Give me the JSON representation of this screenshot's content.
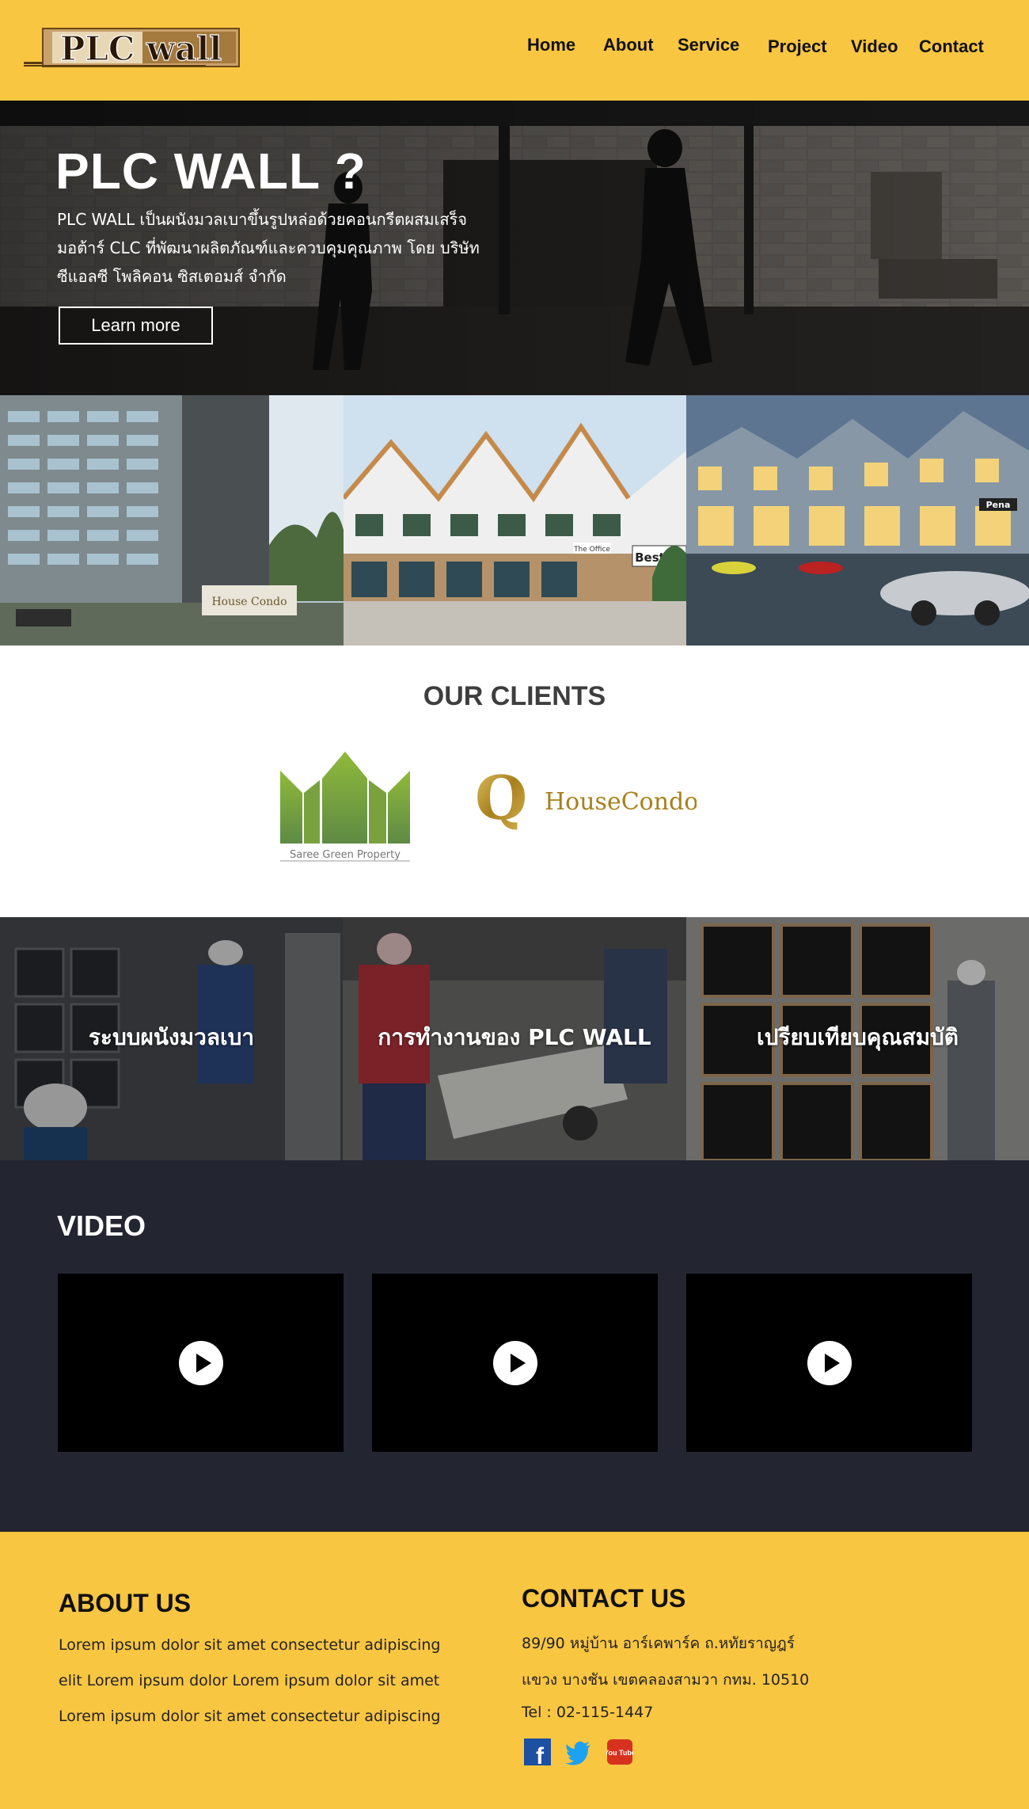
{
  "header": {
    "logo_text": "PLC wall",
    "nav": [
      "Home",
      "About",
      "Service",
      "Project",
      "Video",
      "Contact"
    ]
  },
  "hero": {
    "title": "PLC WALL ?",
    "description_lines": [
      "PLC WALL เป็นผนังมวลเบาขึ้นรูปหล่อด้วยคอนกรีตผสมเสร็จ",
      "มอต้าร์ CLC ที่พัฒนาผลิตภัณฑ์และควบคุมคุณภาพ  โดย บริษัท",
      "ซีแอลซี โพลิคอน ซิสเตอมส์ จำกัด"
    ],
    "button_label": "Learn more"
  },
  "gallery": {
    "signs": [
      "House Condo",
      "Best Av",
      "The Office",
      "Pena"
    ]
  },
  "clients": {
    "title": "OUR CLIENTS",
    "logos": [
      {
        "name": "Saree Green Property",
        "icon": "saree-green-logo"
      },
      {
        "name": "HouseCondo",
        "initial": "Q",
        "icon": "qhouse-condo-logo"
      }
    ]
  },
  "tiles": [
    {
      "label": "ระบบผนังมวลเบา"
    },
    {
      "label": "การทำงานของ PLC WALL"
    },
    {
      "label": "เปรียบเทียบคุณสมบัติ"
    }
  ],
  "video": {
    "title": "VIDEO",
    "items": [
      "video-1",
      "video-2",
      "video-3"
    ]
  },
  "footer": {
    "about_title": "ABOUT US",
    "about_lines": [
      "Lorem ipsum dolor sit amet consectetur adipiscing",
      "elit Lorem ipsum dolor  Lorem ipsum dolor sit amet",
      "Lorem ipsum dolor sit amet consectetur adipiscing"
    ],
    "contact_title": "CONTACT US",
    "contact_lines": [
      "89/90 หมู่บ้าน อาร์เคพาร์ค ถ.หทัยราญฎร์",
      "แขวง บางชัน เขตคลองสามวา กทม. 10510",
      "Tel :  02-115-1447"
    ],
    "social": [
      {
        "name": "facebook",
        "glyph": "f",
        "color": "#1d4fa3"
      },
      {
        "name": "twitter",
        "color": "#1da1f2"
      },
      {
        "name": "youtube",
        "glyph": "You Tube",
        "color": "#d6321f"
      }
    ]
  },
  "colors": {
    "accent_yellow": "#f9c642",
    "video_bg": "#232530"
  }
}
